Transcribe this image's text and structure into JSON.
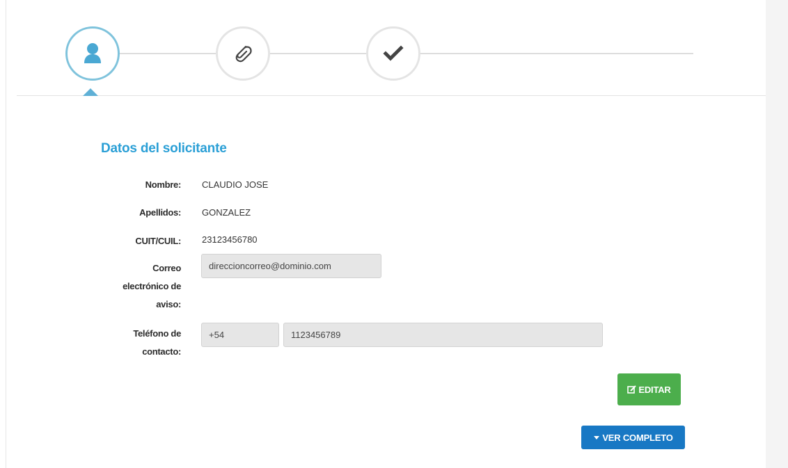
{
  "stepper": {
    "steps": [
      {
        "icon": "user-icon",
        "state": "active"
      },
      {
        "icon": "paperclip-icon",
        "state": "inactive"
      },
      {
        "icon": "checkmark-icon",
        "state": "inactive"
      }
    ]
  },
  "section": {
    "title": "Datos del solicitante"
  },
  "fields": {
    "nombre": {
      "label": "Nombre:",
      "value": "CLAUDIO JOSE"
    },
    "apellidos": {
      "label": "Apellidos:",
      "value": "GONZALEZ"
    },
    "cuit": {
      "label": "CUIT/CUIL:",
      "value": "23123456780"
    },
    "correo": {
      "label_line1": "Correo",
      "label_line2": "electrónico de",
      "label_line3": "aviso:",
      "value": "direccioncorreo@dominio.com"
    },
    "telefono": {
      "label_line1": "Teléfono de",
      "label_line2": "contacto:",
      "prefix": "+54",
      "number": "1123456789"
    }
  },
  "buttons": {
    "edit_label": "EDITAR",
    "more_label": "VER COMPLETO"
  },
  "colors": {
    "accent": "#2a9fd6",
    "edit_button": "#4cae4c",
    "more_button": "#1878c4"
  }
}
